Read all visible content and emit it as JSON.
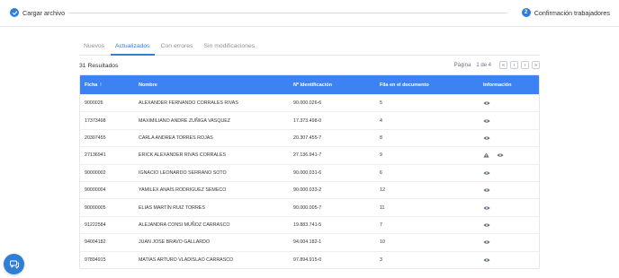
{
  "stepper": {
    "step1": {
      "label": "Cargar archivo"
    },
    "step2": {
      "number": "2",
      "label": "Confirmación trabajadores"
    }
  },
  "tabs": [
    {
      "label": "Nuevos",
      "active": false
    },
    {
      "label": "Actualizados",
      "active": true
    },
    {
      "label": "Con errores",
      "active": false
    },
    {
      "label": "Sin modificaciones",
      "active": false
    }
  ],
  "results": {
    "count_label": "31 Resultados"
  },
  "pager": {
    "label": "Página",
    "info": "1 de 4",
    "first": "«",
    "prev": "‹",
    "next": "›",
    "last": "»"
  },
  "table": {
    "headers": {
      "ficha": "Ficha",
      "nombre": "Nombre",
      "nid": "Nº Identificación",
      "fila": "Fila en el documento",
      "info": "Información"
    },
    "sort_icon": "↑",
    "rows": [
      {
        "ficha": "9000026",
        "nombre": "ALEXANDER FERNANDO CORRALES RIVAS",
        "nid": "90.000.026-6",
        "fila": "5",
        "warning": false
      },
      {
        "ficha": "17373498",
        "nombre": "MAXIMILIANO ANDRE ZUÑIGA VASQUEZ",
        "nid": "17.373.498-0",
        "fila": "4",
        "warning": false
      },
      {
        "ficha": "20307455",
        "nombre": "CARLA ANDREA TORRES ROJAS",
        "nid": "20.307.455-7",
        "fila": "8",
        "warning": false
      },
      {
        "ficha": "27136941",
        "nombre": "ERICK ALEXANDER RIVAS CORRALES",
        "nid": "27.136.941-7",
        "fila": "9",
        "warning": true
      },
      {
        "ficha": "90000002",
        "nombre": "IGNACIO LEONARDO SERRANO SOTO",
        "nid": "90.000.031-6",
        "fila": "6",
        "warning": false
      },
      {
        "ficha": "90000004",
        "nombre": "YAMILEX ANAÍS RODRIGUEZ SEMECO",
        "nid": "90.000.033-2",
        "fila": "12",
        "warning": false
      },
      {
        "ficha": "90000005",
        "nombre": "ELIAS MARTÍN RUIZ TORRES",
        "nid": "90.000.005-7",
        "fila": "11",
        "warning": false
      },
      {
        "ficha": "91222584",
        "nombre": "ALEJANDRA CONSI MUÑOZ CARRASCO",
        "nid": "19.883.741-5",
        "fila": "7",
        "warning": false
      },
      {
        "ficha": "94004182",
        "nombre": "JUAN JOSE BRAVO GALLARDO",
        "nid": "94.004.182-1",
        "fila": "10",
        "warning": false
      },
      {
        "ficha": "97894915",
        "nombre": "MATIAS ARTURO VLADISLAO CARRASCO",
        "nid": "97.894.915-0",
        "fila": "3",
        "warning": false
      }
    ]
  },
  "icons": {
    "step1": "check-icon",
    "row_info": "eye-icon",
    "row_warning": "warning-icon",
    "fab": "chat-icon"
  },
  "colors": {
    "accent": "#2f7ed8",
    "table_header": "#3d82f2"
  }
}
